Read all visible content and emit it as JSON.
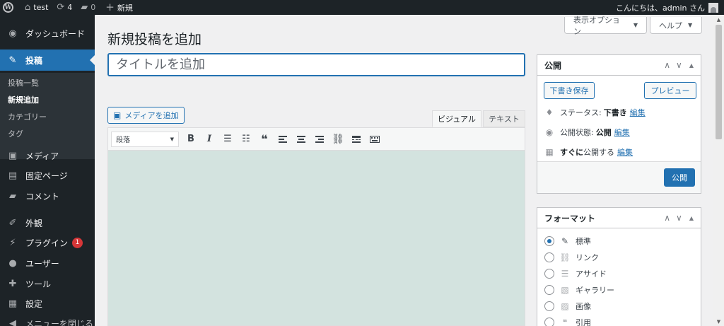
{
  "adminbar": {
    "site_name": "test",
    "updates_count": "4",
    "comments_count": "0",
    "new_label": "新規",
    "greeting": "こんにちは、admin さん"
  },
  "sidebar": {
    "dashboard": "ダッシュボード",
    "posts": "投稿",
    "sub_all_posts": "投稿一覧",
    "sub_add_new": "新規追加",
    "sub_categories": "カテゴリー",
    "sub_tags": "タグ",
    "media": "メディア",
    "pages": "固定ページ",
    "comments": "コメント",
    "appearance": "外観",
    "plugins": "プラグイン",
    "plugins_badge": "1",
    "users": "ユーザー",
    "tools": "ツール",
    "settings": "設定",
    "collapse": "メニューを閉じる"
  },
  "screen_meta": {
    "options": "表示オプション",
    "help": "ヘルプ"
  },
  "page": {
    "title": "新規投稿を追加",
    "title_placeholder": "タイトルを追加"
  },
  "editor": {
    "add_media": "メディアを追加",
    "tab_visual": "ビジュアル",
    "tab_text": "テキスト",
    "format_select": "段落",
    "bold": "B",
    "italic": "I",
    "blockquote": "❝"
  },
  "publish_box": {
    "title": "公開",
    "save_draft": "下書き保存",
    "preview": "プレビュー",
    "status_label": "ステータス:",
    "status_value": "下書き",
    "visibility_label": "公開状態:",
    "visibility_value": "公開",
    "schedule_bold": "すぐに",
    "schedule_text": "公開する",
    "edit": "編集",
    "publish_button": "公開"
  },
  "format_box": {
    "title": "フォーマット",
    "options": [
      "標準",
      "リンク",
      "アサイド",
      "ギャラリー",
      "画像",
      "引用"
    ],
    "selected": "標準"
  },
  "colors": {
    "accent": "#2271b1",
    "admin_bg": "#1d2327",
    "editor_bg": "#d3e3df"
  }
}
